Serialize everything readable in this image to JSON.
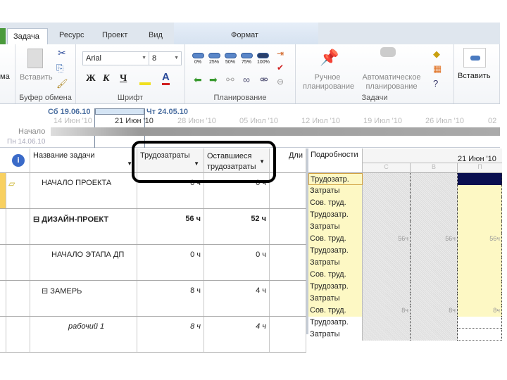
{
  "ribbon": {
    "tabs": [
      "Задача",
      "Ресурс",
      "Проект",
      "Вид"
    ],
    "context_tab": "Формат",
    "left_cut": "ма",
    "clipboard": {
      "paste": "Вставить",
      "label": "Буфер обмена"
    },
    "font": {
      "name": "Arial",
      "size": "8",
      "bold": "Ж",
      "italic": "К",
      "underline": "Ч",
      "label": "Шрифт"
    },
    "schedule": {
      "pcts": [
        "0%",
        "25%",
        "50%",
        "75%",
        "100%"
      ],
      "label": "Планирование"
    },
    "tasks": {
      "manual": "Ручное планирование",
      "auto": "Автоматическое планирование",
      "label": "Задачи"
    },
    "insert": {
      "label": "Вставить"
    }
  },
  "timeline": {
    "start_date": "Сб 19.06.10",
    "end_date": "Чт 24.05.10",
    "ticks": [
      "14 Июн '10",
      "21 Июн '10",
      "28 Июн '10",
      "05 Июл '10",
      "12 Июл '10",
      "19 Июл '10",
      "26 Июл '10",
      "02 ."
    ],
    "start_label": "Начало",
    "start_sub": "Пн 14.06.10"
  },
  "grid": {
    "headers": {
      "name": "Название задачи",
      "work": "Трудозатраты",
      "remaining": "Оставшиеся трудозатраты",
      "duration": "Дли"
    },
    "rows": [
      {
        "name": "НАЧАЛО ПРОЕКТА",
        "work": "0 ч",
        "remaining": "0 ч",
        "style": "normal",
        "indent": 1,
        "note": true
      },
      {
        "name": "ДИЗАЙН-ПРОЕКТ",
        "work": "56 ч",
        "remaining": "52 ч",
        "style": "bold",
        "indent": 0,
        "collapse": "⊟"
      },
      {
        "name": "НАЧАЛО ЭТАПА ДП",
        "work": "0 ч",
        "remaining": "0 ч",
        "style": "normal",
        "indent": 2
      },
      {
        "name": "ЗАМЕРЬ",
        "work": "8 ч",
        "remaining": "4 ч",
        "style": "normal",
        "indent": 1,
        "collapse": "⊟"
      },
      {
        "name": "рабочий 1",
        "work": "8 ч",
        "remaining": "4 ч",
        "style": "italic",
        "indent": 3
      }
    ]
  },
  "details": {
    "header": "Подробности",
    "week": "21 Июн '10",
    "days": [
      "С",
      "В",
      "П"
    ],
    "rows": [
      {
        "label": "Трудозатр.",
        "v": [
          "",
          "",
          ""
        ]
      },
      {
        "label": "Затраты",
        "v": [
          "",
          "",
          ""
        ]
      },
      {
        "label": "Сов. труд.",
        "v": [
          "",
          "",
          ""
        ]
      },
      {
        "label": "Трудозатр.",
        "v": [
          "",
          "",
          ""
        ]
      },
      {
        "label": "Затраты",
        "v": [
          "",
          "",
          ""
        ]
      },
      {
        "label": "Сов. труд.",
        "v": [
          "56ч",
          "56ч",
          "56ч"
        ]
      },
      {
        "label": "Трудозатр.",
        "v": [
          "",
          "",
          ""
        ]
      },
      {
        "label": "Затраты",
        "v": [
          "",
          "",
          ""
        ]
      },
      {
        "label": "Сов. труд.",
        "v": [
          "",
          "",
          ""
        ]
      },
      {
        "label": "Трудозатр.",
        "v": [
          "",
          "",
          ""
        ]
      },
      {
        "label": "Затраты",
        "v": [
          "",
          "",
          ""
        ]
      },
      {
        "label": "Сов. труд.",
        "v": [
          "8ч",
          "8ч",
          "8ч"
        ]
      },
      {
        "label": "Трудозатр.",
        "v": [
          "",
          "",
          ""
        ]
      },
      {
        "label": "Затраты",
        "v": [
          "",
          "",
          ""
        ]
      }
    ]
  },
  "colors": {
    "highlight": "#fdf8c4",
    "selected": "#0a0f50",
    "accent": "#3c6cb4"
  }
}
